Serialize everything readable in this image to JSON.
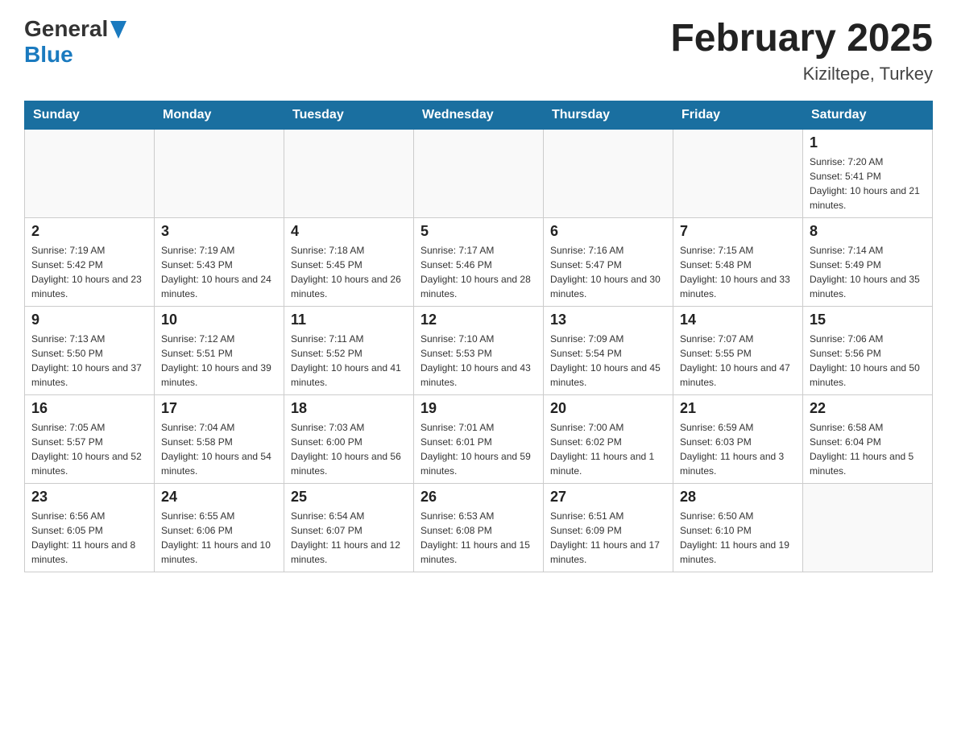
{
  "header": {
    "logo_general": "General",
    "logo_blue": "Blue",
    "title": "February 2025",
    "location": "Kiziltepe, Turkey"
  },
  "days_of_week": [
    "Sunday",
    "Monday",
    "Tuesday",
    "Wednesday",
    "Thursday",
    "Friday",
    "Saturday"
  ],
  "weeks": [
    [
      {
        "day": "",
        "sunrise": "",
        "sunset": "",
        "daylight": ""
      },
      {
        "day": "",
        "sunrise": "",
        "sunset": "",
        "daylight": ""
      },
      {
        "day": "",
        "sunrise": "",
        "sunset": "",
        "daylight": ""
      },
      {
        "day": "",
        "sunrise": "",
        "sunset": "",
        "daylight": ""
      },
      {
        "day": "",
        "sunrise": "",
        "sunset": "",
        "daylight": ""
      },
      {
        "day": "",
        "sunrise": "",
        "sunset": "",
        "daylight": ""
      },
      {
        "day": "1",
        "sunrise": "Sunrise: 7:20 AM",
        "sunset": "Sunset: 5:41 PM",
        "daylight": "Daylight: 10 hours and 21 minutes."
      }
    ],
    [
      {
        "day": "2",
        "sunrise": "Sunrise: 7:19 AM",
        "sunset": "Sunset: 5:42 PM",
        "daylight": "Daylight: 10 hours and 23 minutes."
      },
      {
        "day": "3",
        "sunrise": "Sunrise: 7:19 AM",
        "sunset": "Sunset: 5:43 PM",
        "daylight": "Daylight: 10 hours and 24 minutes."
      },
      {
        "day": "4",
        "sunrise": "Sunrise: 7:18 AM",
        "sunset": "Sunset: 5:45 PM",
        "daylight": "Daylight: 10 hours and 26 minutes."
      },
      {
        "day": "5",
        "sunrise": "Sunrise: 7:17 AM",
        "sunset": "Sunset: 5:46 PM",
        "daylight": "Daylight: 10 hours and 28 minutes."
      },
      {
        "day": "6",
        "sunrise": "Sunrise: 7:16 AM",
        "sunset": "Sunset: 5:47 PM",
        "daylight": "Daylight: 10 hours and 30 minutes."
      },
      {
        "day": "7",
        "sunrise": "Sunrise: 7:15 AM",
        "sunset": "Sunset: 5:48 PM",
        "daylight": "Daylight: 10 hours and 33 minutes."
      },
      {
        "day": "8",
        "sunrise": "Sunrise: 7:14 AM",
        "sunset": "Sunset: 5:49 PM",
        "daylight": "Daylight: 10 hours and 35 minutes."
      }
    ],
    [
      {
        "day": "9",
        "sunrise": "Sunrise: 7:13 AM",
        "sunset": "Sunset: 5:50 PM",
        "daylight": "Daylight: 10 hours and 37 minutes."
      },
      {
        "day": "10",
        "sunrise": "Sunrise: 7:12 AM",
        "sunset": "Sunset: 5:51 PM",
        "daylight": "Daylight: 10 hours and 39 minutes."
      },
      {
        "day": "11",
        "sunrise": "Sunrise: 7:11 AM",
        "sunset": "Sunset: 5:52 PM",
        "daylight": "Daylight: 10 hours and 41 minutes."
      },
      {
        "day": "12",
        "sunrise": "Sunrise: 7:10 AM",
        "sunset": "Sunset: 5:53 PM",
        "daylight": "Daylight: 10 hours and 43 minutes."
      },
      {
        "day": "13",
        "sunrise": "Sunrise: 7:09 AM",
        "sunset": "Sunset: 5:54 PM",
        "daylight": "Daylight: 10 hours and 45 minutes."
      },
      {
        "day": "14",
        "sunrise": "Sunrise: 7:07 AM",
        "sunset": "Sunset: 5:55 PM",
        "daylight": "Daylight: 10 hours and 47 minutes."
      },
      {
        "day": "15",
        "sunrise": "Sunrise: 7:06 AM",
        "sunset": "Sunset: 5:56 PM",
        "daylight": "Daylight: 10 hours and 50 minutes."
      }
    ],
    [
      {
        "day": "16",
        "sunrise": "Sunrise: 7:05 AM",
        "sunset": "Sunset: 5:57 PM",
        "daylight": "Daylight: 10 hours and 52 minutes."
      },
      {
        "day": "17",
        "sunrise": "Sunrise: 7:04 AM",
        "sunset": "Sunset: 5:58 PM",
        "daylight": "Daylight: 10 hours and 54 minutes."
      },
      {
        "day": "18",
        "sunrise": "Sunrise: 7:03 AM",
        "sunset": "Sunset: 6:00 PM",
        "daylight": "Daylight: 10 hours and 56 minutes."
      },
      {
        "day": "19",
        "sunrise": "Sunrise: 7:01 AM",
        "sunset": "Sunset: 6:01 PM",
        "daylight": "Daylight: 10 hours and 59 minutes."
      },
      {
        "day": "20",
        "sunrise": "Sunrise: 7:00 AM",
        "sunset": "Sunset: 6:02 PM",
        "daylight": "Daylight: 11 hours and 1 minute."
      },
      {
        "day": "21",
        "sunrise": "Sunrise: 6:59 AM",
        "sunset": "Sunset: 6:03 PM",
        "daylight": "Daylight: 11 hours and 3 minutes."
      },
      {
        "day": "22",
        "sunrise": "Sunrise: 6:58 AM",
        "sunset": "Sunset: 6:04 PM",
        "daylight": "Daylight: 11 hours and 5 minutes."
      }
    ],
    [
      {
        "day": "23",
        "sunrise": "Sunrise: 6:56 AM",
        "sunset": "Sunset: 6:05 PM",
        "daylight": "Daylight: 11 hours and 8 minutes."
      },
      {
        "day": "24",
        "sunrise": "Sunrise: 6:55 AM",
        "sunset": "Sunset: 6:06 PM",
        "daylight": "Daylight: 11 hours and 10 minutes."
      },
      {
        "day": "25",
        "sunrise": "Sunrise: 6:54 AM",
        "sunset": "Sunset: 6:07 PM",
        "daylight": "Daylight: 11 hours and 12 minutes."
      },
      {
        "day": "26",
        "sunrise": "Sunrise: 6:53 AM",
        "sunset": "Sunset: 6:08 PM",
        "daylight": "Daylight: 11 hours and 15 minutes."
      },
      {
        "day": "27",
        "sunrise": "Sunrise: 6:51 AM",
        "sunset": "Sunset: 6:09 PM",
        "daylight": "Daylight: 11 hours and 17 minutes."
      },
      {
        "day": "28",
        "sunrise": "Sunrise: 6:50 AM",
        "sunset": "Sunset: 6:10 PM",
        "daylight": "Daylight: 11 hours and 19 minutes."
      },
      {
        "day": "",
        "sunrise": "",
        "sunset": "",
        "daylight": ""
      }
    ]
  ]
}
